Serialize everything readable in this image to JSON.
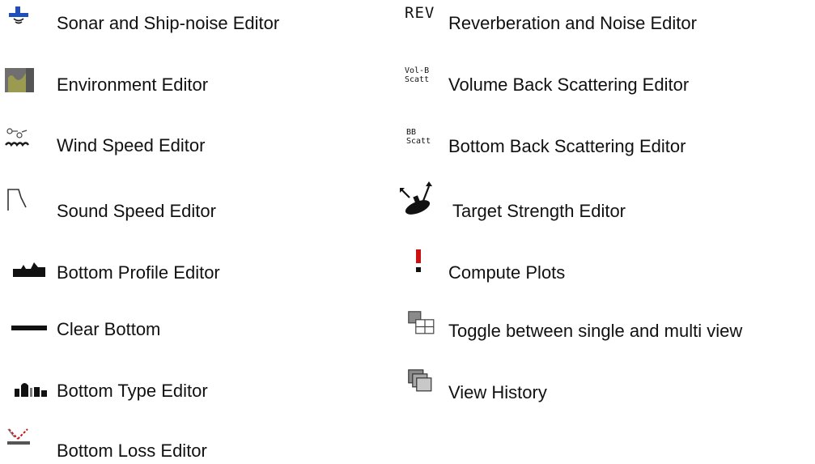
{
  "left_column": [
    {
      "icon": "sonar-ship-icon",
      "label": "Sonar and Ship-noise Editor"
    },
    {
      "icon": "environment-icon",
      "label": "Environment Editor"
    },
    {
      "icon": "wind-speed-icon",
      "label": "Wind Speed Editor"
    },
    {
      "icon": "sound-speed-icon",
      "label": "Sound Speed Editor"
    },
    {
      "icon": "bottom-profile-icon",
      "label": "Bottom Profile Editor"
    },
    {
      "icon": "clear-bottom-icon",
      "label": "Clear Bottom"
    },
    {
      "icon": "bottom-type-icon",
      "label": "Bottom Type Editor"
    },
    {
      "icon": "bottom-loss-icon",
      "label": "Bottom Loss Editor"
    }
  ],
  "right_column": [
    {
      "icon": "reverberation-icon",
      "icon_text": "REV",
      "label": "Reverberation and Noise Editor"
    },
    {
      "icon": "volume-scattering-icon",
      "icon_text": [
        "Vol-B",
        "Scatt"
      ],
      "label": "Volume Back Scattering Editor"
    },
    {
      "icon": "bottom-scattering-icon",
      "icon_text": [
        "BB",
        "Scatt"
      ],
      "label": "Bottom Back Scattering Editor"
    },
    {
      "icon": "target-strength-icon",
      "label": "Target Strength Editor"
    },
    {
      "icon": "compute-plots-icon",
      "label": "Compute Plots"
    },
    {
      "icon": "toggle-view-icon",
      "label": "Toggle between single and multi view"
    },
    {
      "icon": "view-history-icon",
      "label": "View History"
    }
  ],
  "colors": {
    "text": "#111111",
    "icon_blue": "#1f4fbf",
    "icon_dark": "#1a1a1a",
    "icon_olive": "#9a9a50",
    "icon_red": "#cc1111",
    "icon_gray": "#8a8a8a"
  }
}
